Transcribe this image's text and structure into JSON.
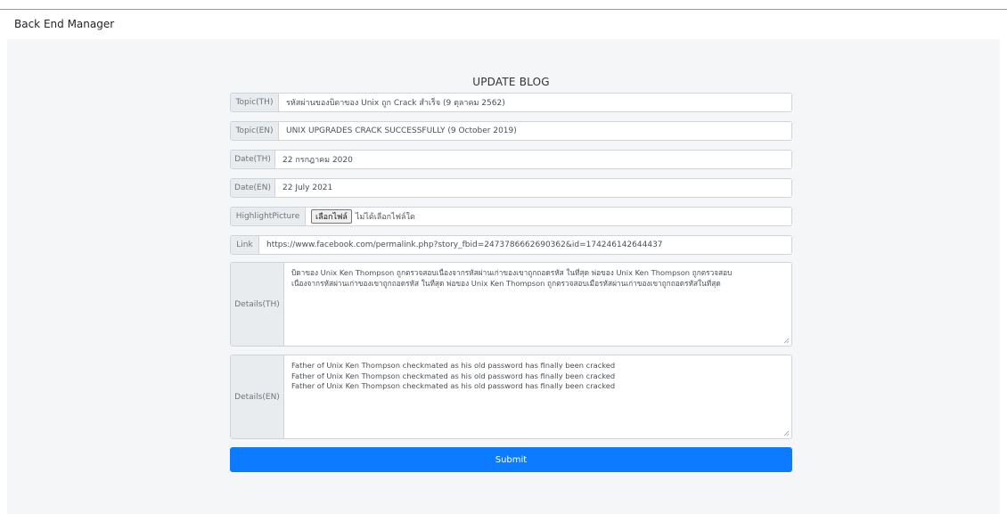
{
  "navbar": {
    "brand": "Back End Manager"
  },
  "form": {
    "title": "UPDATE BLOG",
    "topic_th": {
      "label": "Topic(TH)",
      "value": "รหัสผ่านของบิดาของ Unix ถูก Crack สำเร็จ (9 ตุลาคม 2562)"
    },
    "topic_en": {
      "label": "Topic(EN)",
      "value": "UNIX UPGRADES CRACK SUCCESSFULLY (9 October 2019)"
    },
    "date_th": {
      "label": "Date(TH)",
      "value": "22 กรกฎาคม 2020"
    },
    "date_en": {
      "label": "Date(EN)",
      "value": "22 July 2021"
    },
    "highlight": {
      "label": "HighlightPicture",
      "button": "เลือกไฟล์",
      "status": "ไม่ได้เลือกไฟล์ใด"
    },
    "link": {
      "label": "Link",
      "value": "https://www.facebook.com/permalink.php?story_fbid=2473786662690362&id=174246142644437"
    },
    "details_th": {
      "label": "Details(TH)",
      "lines": [
        "บิดาของ Unix Ken Thompson ถูกตรวจสอบเนื่องจากรหัสผ่านเก่าของเขาถูกถอดรหัส ในที่สุด พ่อของ Unix Ken Thompson ถูกตรวจสอบ",
        "เนื่องจากรหัสผ่านเก่าของเขาถูกถอดรหัส ในที่สุด พ่อของ Unix Ken Thompson ถูกตรวจสอบเมื่อรหัสผ่านเก่าของเขาถูกถอดรหัสในที่สุด"
      ]
    },
    "details_en": {
      "label": "Details(EN)",
      "lines": [
        "Father of Unix Ken Thompson checkmated as his old password has finally been cracked",
        "Father of Unix Ken Thompson checkmated as his old password has finally been cracked",
        "Father of Unix Ken Thompson checkmated as his old password has finally been cracked"
      ]
    },
    "submit_label": "Submit"
  },
  "colors": {
    "accent": "#0d7bff",
    "addon_bg": "#e9ecef",
    "panel_bg": "#f5f6f7"
  }
}
